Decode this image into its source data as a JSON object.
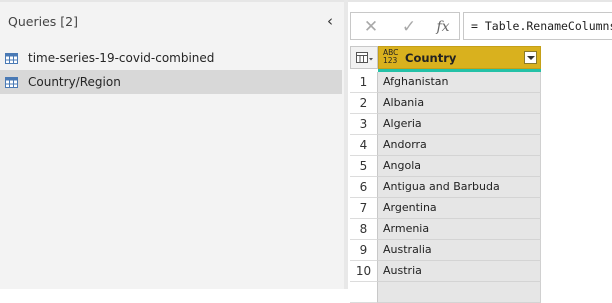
{
  "queries_pane": {
    "title": "Queries [2]",
    "collapse_icon": "chevron-left-icon",
    "items": [
      {
        "label": "time-series-19-covid-combined",
        "icon": "table-icon",
        "selected": false
      },
      {
        "label": "Country/Region",
        "icon": "table-icon",
        "selected": true
      }
    ]
  },
  "formula_bar": {
    "cancel_glyph": "✕",
    "commit_glyph": "✓",
    "fx_glyph": "fx",
    "formula": "= Table.RenameColumns"
  },
  "grid": {
    "corner_icon": "table-menu-icon",
    "column": {
      "type_line1": "ABC",
      "type_line2": "123",
      "name": "Country",
      "header_color": "#d9b11e",
      "quality_color": "#24c1a7"
    },
    "rows": [
      {
        "n": "1",
        "v": "Afghanistan"
      },
      {
        "n": "2",
        "v": "Albania"
      },
      {
        "n": "3",
        "v": "Algeria"
      },
      {
        "n": "4",
        "v": "Andorra"
      },
      {
        "n": "5",
        "v": "Angola"
      },
      {
        "n": "6",
        "v": "Antigua and Barbuda"
      },
      {
        "n": "7",
        "v": "Argentina"
      },
      {
        "n": "8",
        "v": "Armenia"
      },
      {
        "n": "9",
        "v": "Australia"
      },
      {
        "n": "10",
        "v": "Austria"
      }
    ]
  }
}
